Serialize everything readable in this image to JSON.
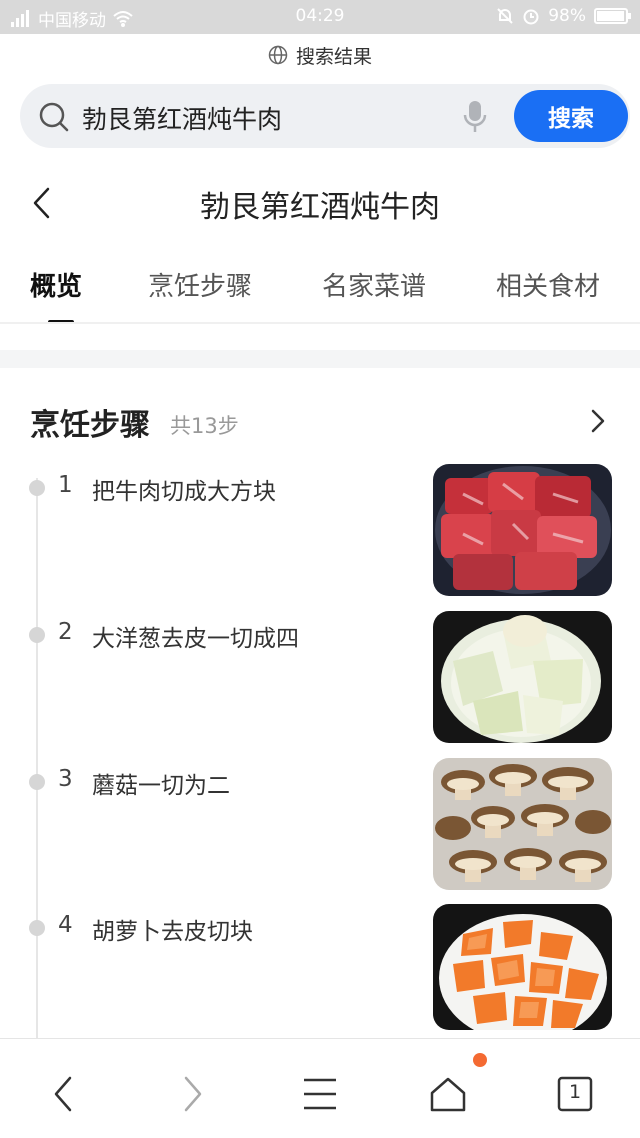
{
  "status_bar": {
    "carrier": "中国移动",
    "time": "04:29",
    "battery": "98%"
  },
  "top_label": "搜索结果",
  "search": {
    "query": "勃艮第红酒炖牛肉",
    "button_label": "搜索"
  },
  "header": {
    "title": "勃艮第红酒炖牛肉"
  },
  "tabs": [
    {
      "label": "概览"
    },
    {
      "label": "烹饪步骤"
    },
    {
      "label": "名家菜谱"
    },
    {
      "label": "相关食材"
    }
  ],
  "section": {
    "title": "烹饪步骤",
    "count": "共13步"
  },
  "steps": [
    {
      "num": "1",
      "text": "把牛肉切成大方块",
      "image": "raw-beef-chunks"
    },
    {
      "num": "2",
      "text": "大洋葱去皮一切成四",
      "image": "onion-quarters"
    },
    {
      "num": "3",
      "text": "蘑菇一切为二",
      "image": "halved-mushrooms"
    },
    {
      "num": "4",
      "text": "胡萝卜去皮切块",
      "image": "carrot-chunks"
    }
  ],
  "bottom_nav": {
    "tab_count": "1"
  },
  "colors": {
    "accent": "#1a6ff4",
    "badge": "#f46a32"
  }
}
